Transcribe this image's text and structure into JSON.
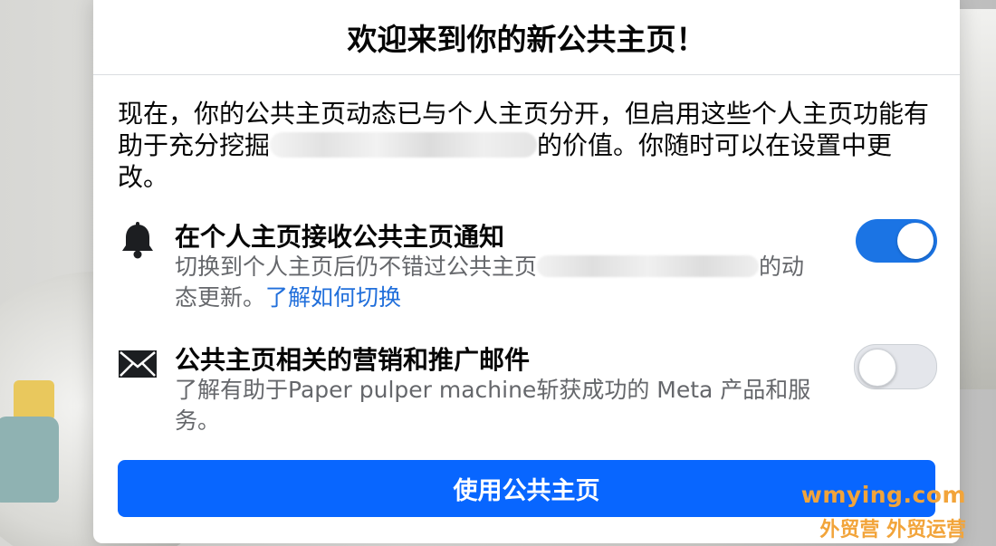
{
  "modal": {
    "title": "欢迎来到你的新公共主页！",
    "intro_part1": "现在，你的公共主页动态已与个人主页分开，但启用这些个人主页功能有助于充分挖掘",
    "intro_part2": "的价值。你随时可以在设置中更改。"
  },
  "settings": [
    {
      "title": "在个人主页接收公共主页通知",
      "desc_part1": "切换到个人主页后仍不错过公共主页",
      "desc_part2": "的动态更新。",
      "link": "了解如何切换",
      "icon": "bell-icon",
      "enabled": true
    },
    {
      "title": "公共主页相关的营销和推广邮件",
      "desc": "了解有助于Paper pulper machine斩获成功的 Meta 产品和服务。",
      "icon": "envelope-icon",
      "enabled": false
    }
  ],
  "actions": {
    "primary": "使用公共主页"
  },
  "watermark": {
    "line1": "wmying.com",
    "line2": "外贸营 外贸运营"
  },
  "colors": {
    "primary": "#0866ff",
    "toggle_on": "#1b74e4",
    "link": "#216fdb",
    "watermark": "#f2a43a"
  }
}
